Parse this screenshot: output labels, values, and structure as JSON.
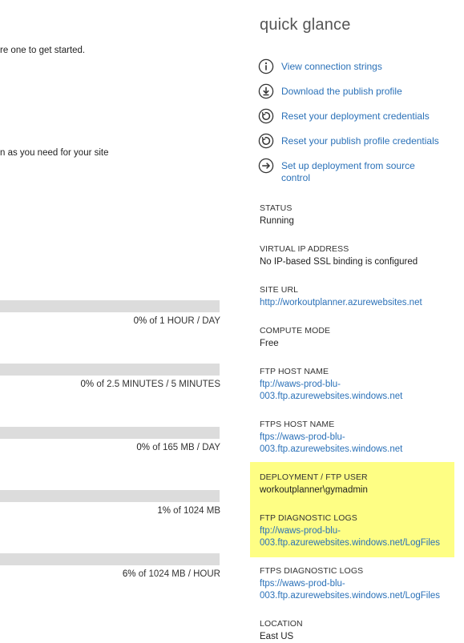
{
  "left": {
    "intro_lines": [
      "re one to get started.",
      "n as you need for your site"
    ],
    "usage": [
      {
        "percent": "0%",
        "suffix": " of 1 HOUR / DAY",
        "fill": 0.0
      },
      {
        "percent": "0%",
        "suffix": " of 2.5 MINUTES / 5 MINUTES",
        "fill": 0.0
      },
      {
        "percent": "0%",
        "suffix": " of 165 MB / DAY",
        "fill": 0.0
      },
      {
        "percent": "1%",
        "suffix": " of 1024 MB",
        "fill": 0.01
      },
      {
        "percent": "6%",
        "suffix": " of 1024 MB / HOUR",
        "fill": 0.06
      }
    ]
  },
  "quick_glance": {
    "title": "quick glance",
    "actions": [
      {
        "label": "View connection strings",
        "icon": "info-icon"
      },
      {
        "label": "Download the publish profile",
        "icon": "download-icon"
      },
      {
        "label": "Reset your deployment credentials",
        "icon": "reset-icon"
      },
      {
        "label": "Reset your publish profile credentials",
        "icon": "reset-icon"
      },
      {
        "label": "Set up deployment from source control",
        "icon": "arrow-right-icon"
      }
    ],
    "properties": {
      "status": {
        "key": "STATUS",
        "value": "Running"
      },
      "virtual_ip": {
        "key": "VIRTUAL IP ADDRESS",
        "value": "No IP-based SSL binding is configured"
      },
      "site_url": {
        "key": "SITE URL",
        "value": "http://workoutplanner.azurewebsites.net"
      },
      "compute_mode": {
        "key": "COMPUTE MODE",
        "value": "Free"
      },
      "ftp_host": {
        "key": "FTP HOST NAME",
        "value": "ftp://waws-prod-blu-003.ftp.azurewebsites.windows.net"
      },
      "ftps_host": {
        "key": "FTPS HOST NAME",
        "value": "ftps://waws-prod-blu-003.ftp.azurewebsites.windows.net"
      },
      "deploy_user": {
        "key": "DEPLOYMENT / FTP USER",
        "value": "workoutplanner\\gymadmin"
      },
      "ftp_logs": {
        "key": "FTP DIAGNOSTIC LOGS",
        "value": "ftp://waws-prod-blu-003.ftp.azurewebsites.windows.net/LogFiles"
      },
      "ftps_logs": {
        "key": "FTPS DIAGNOSTIC LOGS",
        "value": "ftps://waws-prod-blu-003.ftp.azurewebsites.windows.net/LogFiles"
      },
      "location": {
        "key": "LOCATION",
        "value": "East US"
      }
    }
  },
  "colors": {
    "link": "#2b71b8",
    "highlight": "#fefe84",
    "bar": "#dcdcdc"
  }
}
